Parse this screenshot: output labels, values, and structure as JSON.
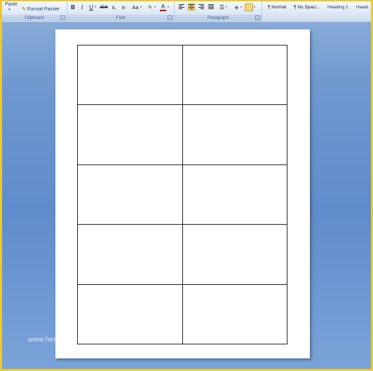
{
  "ribbon": {
    "clipboard": {
      "paste_label": "Paste",
      "format_painter_label": "Format Painter",
      "group_label": "Clipboard"
    },
    "font": {
      "bold": "B",
      "italic": "I",
      "underline": "U",
      "strikethrough": "abe",
      "subscript": "x",
      "superscript": "x",
      "change_case": "Aa",
      "font_color": "A",
      "group_label": "Font"
    },
    "paragraph": {
      "group_label": "Paragraph"
    },
    "styles": [
      {
        "label": "¶ Normal"
      },
      {
        "label": "¶ No Spaci..."
      },
      {
        "label": "Heading 1"
      },
      {
        "label": "Headi"
      }
    ]
  },
  "watermark": "www.heritagechristiancollege.com",
  "colors": {
    "ribbon_text": "#15428b",
    "background": "#6f98cf",
    "highlight": "#f6d67a",
    "outer_border": "#e8c93a"
  }
}
